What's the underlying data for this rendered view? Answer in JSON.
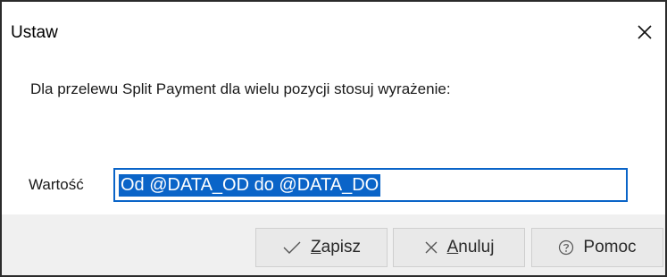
{
  "dialog": {
    "title": "Ustaw",
    "prompt": "Dla przelewu Split Payment dla wielu pozycji stosuj wyrażenie:",
    "field": {
      "label": "Wartość",
      "value": "Od @DATA_OD do @DATA_DO"
    },
    "buttons": {
      "save": {
        "accel": "Z",
        "rest": "apisz",
        "icon": "checkmark-icon"
      },
      "cancel": {
        "accel": "A",
        "rest": "nuluj",
        "icon": "x-icon"
      },
      "help": {
        "label": "Pomoc",
        "icon": "help-circle-icon"
      }
    }
  },
  "colors": {
    "accent": "#0a64c8",
    "footer": "#f0f0f0",
    "border": "#2b2b2b"
  }
}
